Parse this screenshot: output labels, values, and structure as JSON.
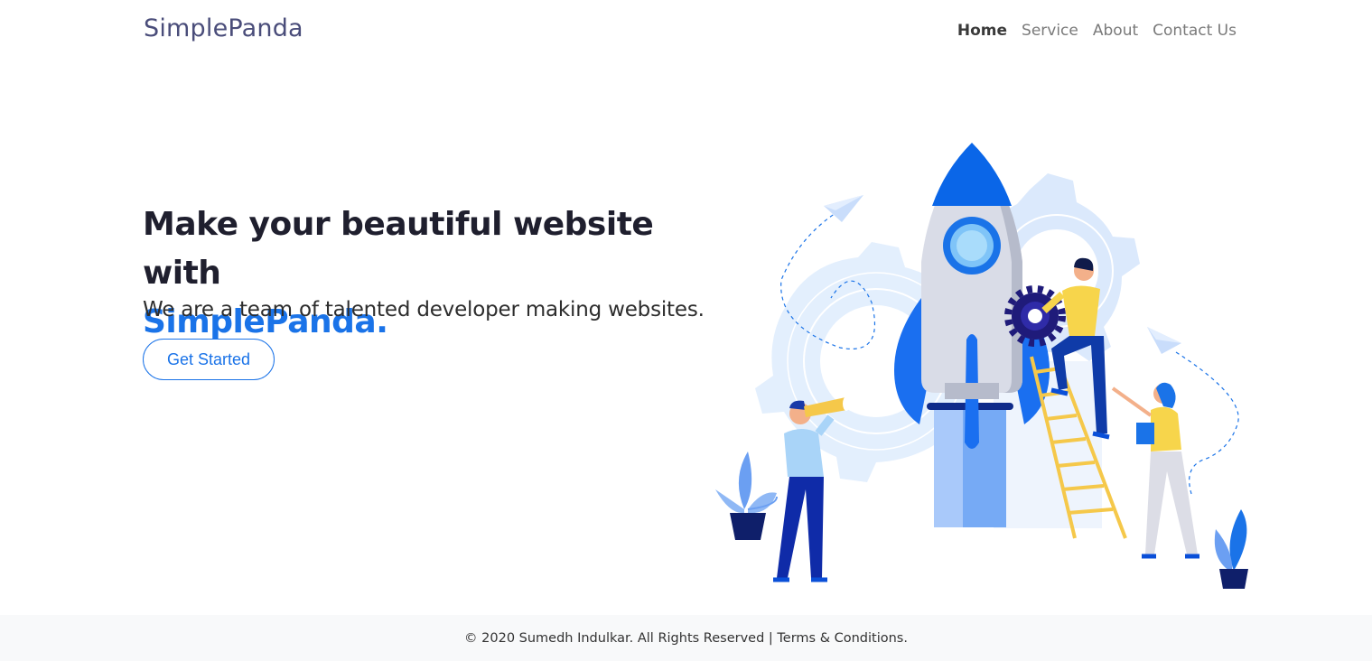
{
  "navbar": {
    "brand": "SimplePanda",
    "links": [
      {
        "label": "Home",
        "active": true
      },
      {
        "label": "Service",
        "active": false
      },
      {
        "label": "About",
        "active": false
      },
      {
        "label": "Contact Us",
        "active": false
      }
    ]
  },
  "hero": {
    "title_line1": "Make your beautiful website with",
    "title_brand": "SimplePanda.",
    "subtitle": "We are a team of talented developer making websites.",
    "cta_label": "Get Started"
  },
  "footer": {
    "text": "© 2020 Sumedh Indulkar. All Rights Reserved | Terms & Conditions."
  },
  "colors": {
    "accent": "#1a73e8",
    "brand_text": "#4a4d7a",
    "footer_bg": "#f8f9fa"
  }
}
